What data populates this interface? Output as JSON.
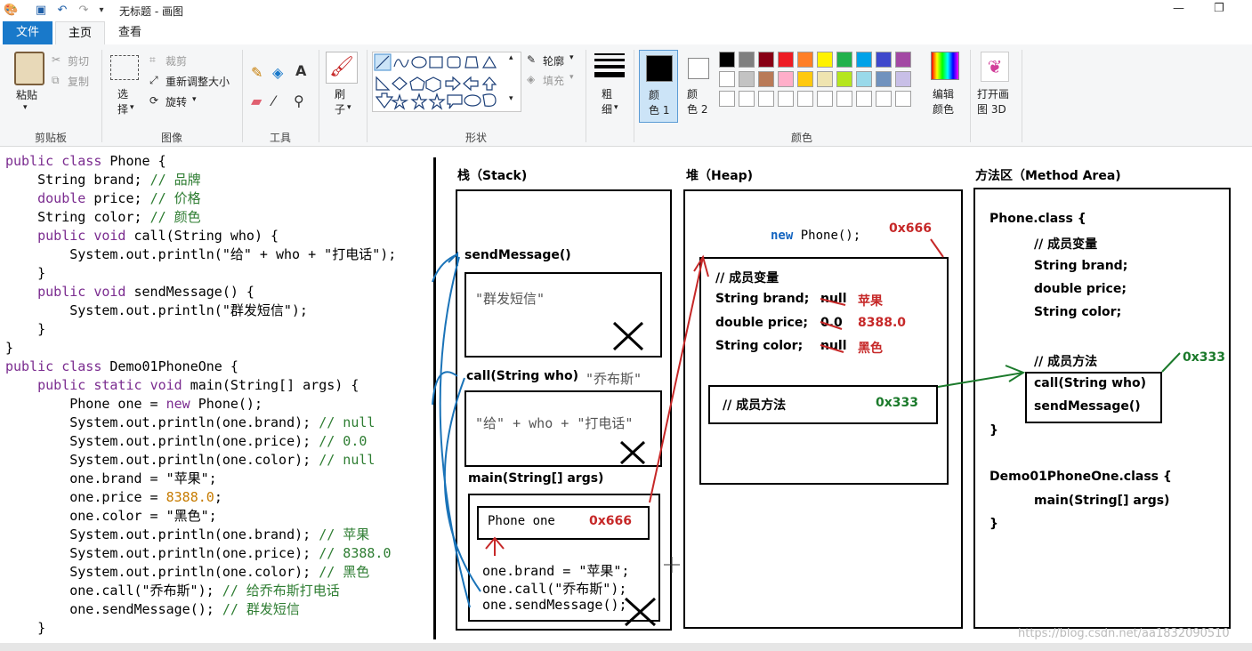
{
  "titlebar": {
    "title": "无标题 - 画图"
  },
  "tabs": {
    "file": "文件",
    "home": "主页",
    "view": "查看"
  },
  "ribbon": {
    "clipboard": {
      "paste": "粘贴",
      "cut": "剪切",
      "copy": "复制",
      "label": "剪贴板"
    },
    "image": {
      "select": "选\n择",
      "crop": "裁剪",
      "resize": "重新调整大小",
      "rotate": "旋转",
      "label": "图像"
    },
    "tools": {
      "label": "工具"
    },
    "brush": {
      "label": "刷\n子"
    },
    "shapes": {
      "outline": "轮廓",
      "fill": "填充",
      "label": "形状"
    },
    "size": {
      "label": "粗\n细"
    },
    "colors": {
      "color1": "颜\n色 1",
      "color2": "颜\n色 2",
      "edit": "编辑\n颜色",
      "label": "颜色",
      "palette": [
        "#000000",
        "#7f7f7f",
        "#880015",
        "#ed1c24",
        "#ff7f27",
        "#fff200",
        "#22b14c",
        "#00a2e8",
        "#3f48cc",
        "#a349a4",
        "#ffffff",
        "#c3c3c3",
        "#b97a57",
        "#ffaec9",
        "#ffc90e",
        "#efe4b0",
        "#b5e61d",
        "#99d9ea",
        "#7092be",
        "#c8bfe7"
      ]
    },
    "paint3d": {
      "label": "打开画\n图 3D"
    }
  },
  "code": [
    "public class Phone {",
    "    String brand; // 品牌",
    "    double price; // 价格",
    "    String color; // 颜色",
    "    public void call(String who) {",
    "        System.out.println(\"给\" + who + \"打电话\");",
    "    }",
    "    public void sendMessage() {",
    "        System.out.println(\"群发短信\");",
    "    }",
    "}",
    "public class Demo01PhoneOne {",
    "    public static void main(String[] args) {",
    "        Phone one = new Phone();",
    "        System.out.println(one.brand); // null",
    "        System.out.println(one.price); // 0.0",
    "        System.out.println(one.color); // null",
    "        one.brand = \"苹果\";",
    "        one.price = 8388.0;",
    "        one.color = \"黑色\";",
    "        System.out.println(one.brand); // 苹果",
    "        System.out.println(one.price); // 8388.0",
    "        System.out.println(one.color); // 黑色",
    "        one.call(\"乔布斯\"); // 给乔布斯打电话",
    "        one.sendMessage(); // 群发短信",
    "    }"
  ],
  "diagram": {
    "stack": {
      "title": "栈（Stack)",
      "send_message": "sendMessage()",
      "send_message_body": "\"群发短信\"",
      "call": "call(String who)",
      "call_arg": "\"乔布斯\"",
      "call_body": "\"给\" + who + \"打电话\"",
      "main": "main(String[] args)",
      "phone_one": "Phone one",
      "phone_addr": "0x666",
      "stmt1": "one.brand = \"苹果\";",
      "stmt2": "one.call(\"乔布斯\");",
      "stmt3": "one.sendMessage();"
    },
    "heap": {
      "title": "堆（Heap)",
      "new_kw": "new",
      "new_rest": "Phone();",
      "addr": "0x666",
      "member_vars": "// 成员变量",
      "brand": "String brand;",
      "brand_old": "null",
      "brand_new": "苹果",
      "price": "double price;",
      "price_old": "0.0",
      "price_new": "8388.0",
      "color": "String color;",
      "color_old": "null",
      "color_new": "黑色",
      "member_methods": "// 成员方法",
      "method_addr": "0x333"
    },
    "method_area": {
      "title": "方法区（Method Area)",
      "phone_class": "Phone.class {",
      "member_vars": "// 成员变量",
      "brand": "String brand;",
      "price": "double price;",
      "color": "String color;",
      "member_methods": "// 成员方法",
      "method_addr": "0x333",
      "call": "call(String who)",
      "send": "sendMessage()",
      "close1": "}",
      "demo_class": "Demo01PhoneOne.class {",
      "main": "main(String[] args)",
      "close2": "}"
    }
  },
  "watermark": "https://blog.csdn.net/aa1832090510"
}
